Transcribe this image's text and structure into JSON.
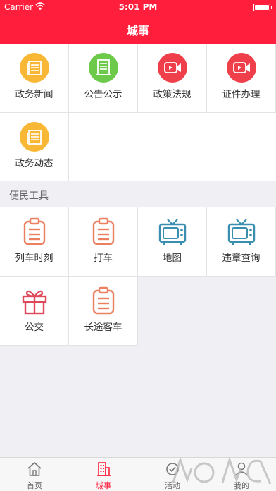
{
  "status_bar": {
    "carrier": "Carrier",
    "time": "5:01 PM"
  },
  "nav": {
    "title": "城事"
  },
  "main_grid": [
    {
      "label": "政务新闻",
      "icon": "news-icon",
      "color": "#f8b836"
    },
    {
      "label": "公告公示",
      "icon": "notice-icon",
      "color": "#6cc94a"
    },
    {
      "label": "政策法规",
      "icon": "video-icon",
      "color": "#ef3f4a"
    },
    {
      "label": "证件办理",
      "icon": "video-icon",
      "color": "#ef3f4a"
    },
    {
      "label": "政务动态",
      "icon": "news-icon",
      "color": "#f8b836"
    }
  ],
  "tools_section": {
    "title": "便民工具"
  },
  "tools_grid": [
    {
      "label": "列车时刻",
      "icon": "clipboard-icon",
      "color": "#ea8060"
    },
    {
      "label": "打车",
      "icon": "clipboard-icon",
      "color": "#ea8060"
    },
    {
      "label": "地图",
      "icon": "tv-icon",
      "color": "#3a8fb0"
    },
    {
      "label": "违章查询",
      "icon": "tv-icon",
      "color": "#3a8fb0"
    },
    {
      "label": "公交",
      "icon": "gift-icon",
      "color": "#e0495a"
    },
    {
      "label": "长途客车",
      "icon": "clipboard-icon",
      "color": "#ea8060"
    }
  ],
  "tabbar": [
    {
      "label": "首页",
      "icon": "home-icon",
      "active": false
    },
    {
      "label": "城事",
      "icon": "building-icon",
      "active": true
    },
    {
      "label": "活动",
      "icon": "activity-icon",
      "active": false
    },
    {
      "label": "我的",
      "icon": "profile-icon",
      "active": false
    }
  ],
  "colors": {
    "brand": "#ff1e3c",
    "tab_active": "#ff1e3c",
    "tab_inactive": "#666666"
  }
}
